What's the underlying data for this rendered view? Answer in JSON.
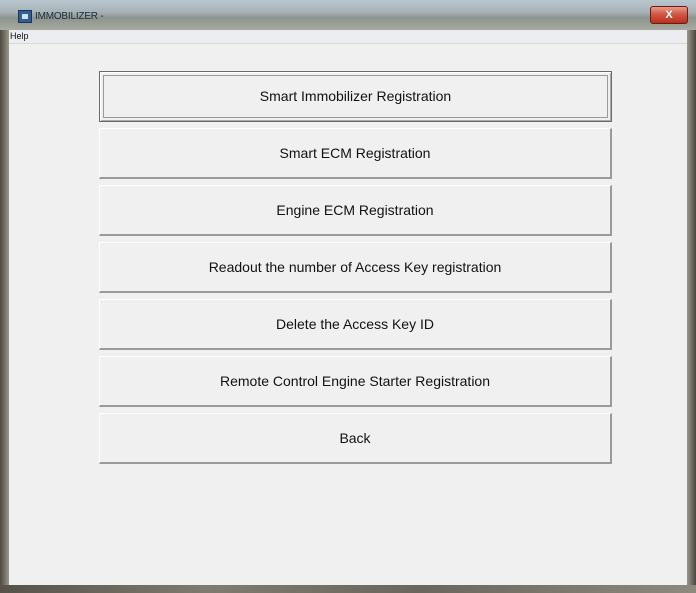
{
  "window": {
    "title": "IMMOBILIZER -",
    "close_label": "X"
  },
  "menu": {
    "items": [
      {
        "label": "Help"
      }
    ]
  },
  "buttons": [
    {
      "label": "Smart Immobilizer Registration"
    },
    {
      "label": "Smart ECM Registration"
    },
    {
      "label": "Engine ECM Registration"
    },
    {
      "label": "Readout the number of Access Key registration"
    },
    {
      "label": "Delete the Access Key ID"
    },
    {
      "label": "Remote Control Engine Starter Registration"
    },
    {
      "label": "Back"
    }
  ]
}
